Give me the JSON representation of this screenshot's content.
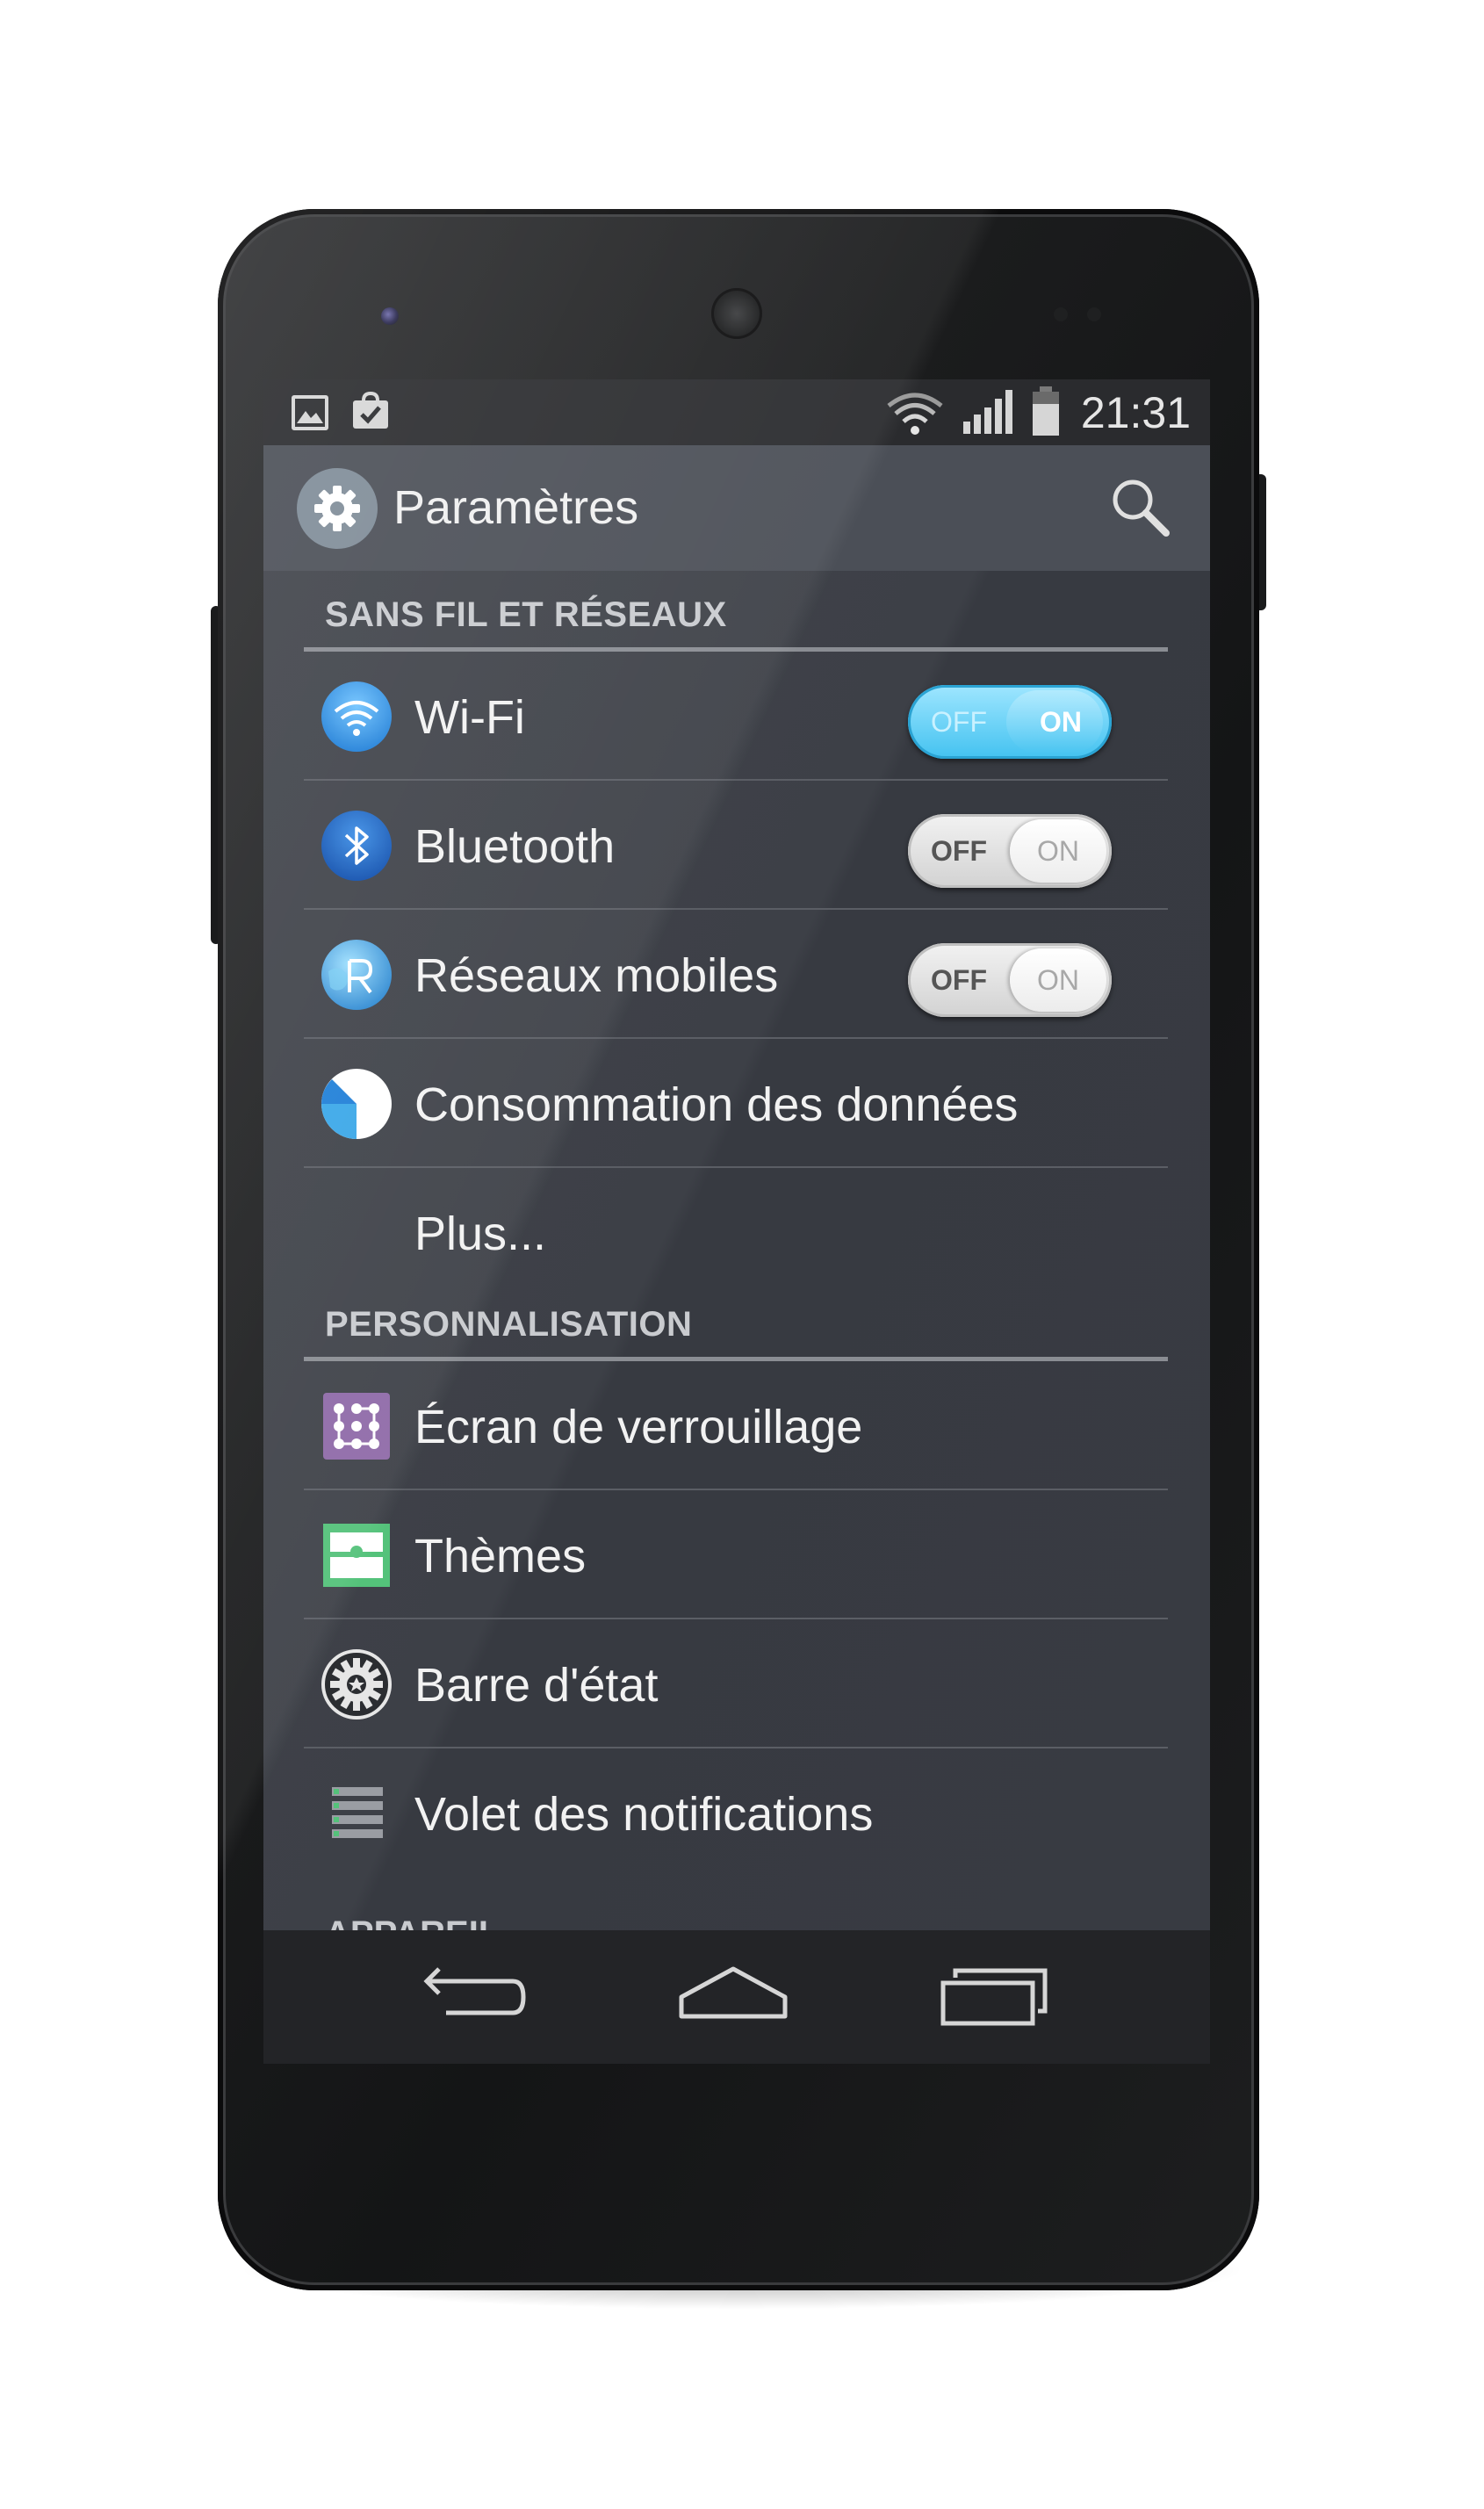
{
  "status_bar": {
    "time": "21:31",
    "icons": [
      "gallery-notification-icon",
      "store-notification-icon",
      "wifi-signal-icon",
      "cell-signal-icon",
      "battery-icon"
    ]
  },
  "action_bar": {
    "title": "Paramètres",
    "logo_icon": "settings-gear-icon",
    "search_icon": "search-icon"
  },
  "sections": [
    {
      "header": "SANS FIL ET RÉSEAUX",
      "items": [
        {
          "label": "Wi-Fi",
          "icon": "wifi-icon",
          "toggle": {
            "state": "on",
            "off_label": "OFF",
            "on_label": "ON"
          }
        },
        {
          "label": "Bluetooth",
          "icon": "bluetooth-icon",
          "toggle": {
            "state": "off",
            "off_label": "OFF",
            "on_label": "ON"
          }
        },
        {
          "label": "Réseaux mobiles",
          "icon": "mobile-networks-icon",
          "toggle": {
            "state": "off",
            "off_label": "OFF",
            "on_label": "ON"
          }
        },
        {
          "label": "Consommation des données",
          "icon": "data-usage-icon"
        },
        {
          "label": "Plus..."
        }
      ]
    },
    {
      "header": "PERSONNALISATION",
      "items": [
        {
          "label": "Écran de verrouillage",
          "icon": "lock-screen-icon"
        },
        {
          "label": "Thèmes",
          "icon": "themes-icon"
        },
        {
          "label": "Barre d'état",
          "icon": "status-bar-icon"
        },
        {
          "label": "Volet des notifications",
          "icon": "notification-drawer-icon"
        }
      ]
    }
  ],
  "next_section_peek": "APPAREIL",
  "nav_bar": {
    "buttons": [
      "back-icon",
      "home-icon",
      "recents-icon"
    ]
  },
  "colors": {
    "screen_bg": "#3a3d44",
    "action_bar_bg": "#4b4f57",
    "toggle_on": "#43c2f0",
    "section_text": "#c9cbcf",
    "divider": "#5b5e65"
  }
}
